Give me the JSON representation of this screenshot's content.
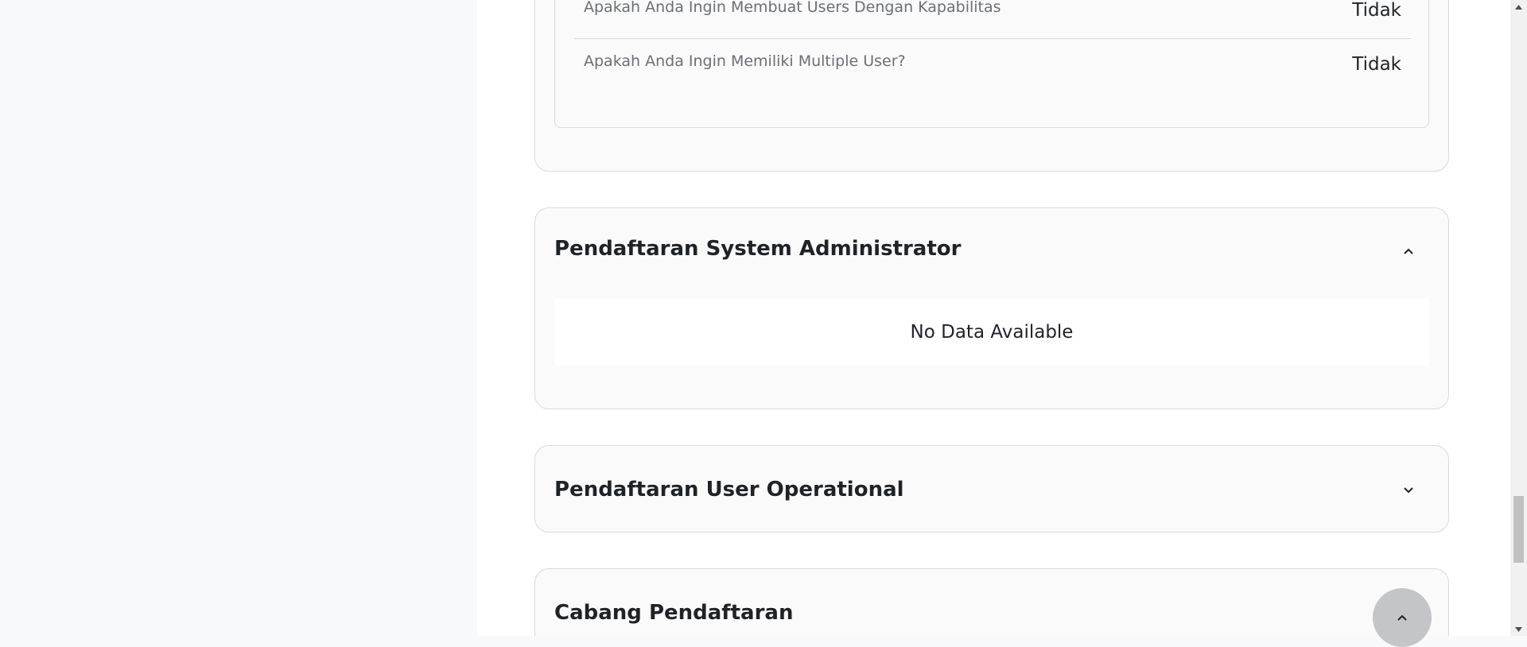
{
  "previous_section": {
    "questions": [
      {
        "question": "Apakah Anda Ingin Membuat Users Dengan Kapabilitas",
        "answer": "Tidak"
      },
      {
        "question": "Apakah Anda Ingin Memiliki Multiple User?",
        "answer": "Tidak"
      }
    ]
  },
  "sections": {
    "admin": {
      "title": "Pendaftaran System Administrator",
      "expanded": true,
      "empty_text": "No Data Available"
    },
    "user": {
      "title": "Pendaftaran User Operational",
      "expanded": false
    },
    "cabang": {
      "title": "Cabang Pendaftaran"
    }
  },
  "icons": {
    "collapse": "chevron-up-icon",
    "expand": "chevron-down-icon",
    "scroll_top": "chevron-up-icon"
  },
  "colors": {
    "border": "#d9dadc",
    "card_bg": "#fafafa",
    "muted_text": "#6b6f76",
    "scroll_top_bg": "#c4c5c7"
  }
}
